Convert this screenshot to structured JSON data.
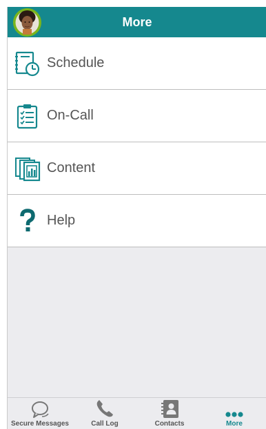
{
  "header": {
    "title": "More"
  },
  "menu": {
    "items": [
      {
        "label": "Schedule",
        "icon": "schedule-icon"
      },
      {
        "label": "On-Call",
        "icon": "on-call-clipboard-icon"
      },
      {
        "label": "Content",
        "icon": "content-chart-icon"
      },
      {
        "label": "Help",
        "icon": "help-question-icon"
      }
    ]
  },
  "tabbar": {
    "tabs": [
      {
        "label": "Secure Messages",
        "icon": "speech-bubbles-icon",
        "active": false
      },
      {
        "label": "Call Log",
        "icon": "phone-icon",
        "active": false
      },
      {
        "label": "Contacts",
        "icon": "contacts-book-icon",
        "active": false
      },
      {
        "label": "More",
        "icon": "more-dots-icon",
        "active": true
      }
    ]
  },
  "colors": {
    "brand": "#15888e",
    "avatar_ring": "#7ab51d",
    "background": "#ececef",
    "text": "#555555"
  }
}
